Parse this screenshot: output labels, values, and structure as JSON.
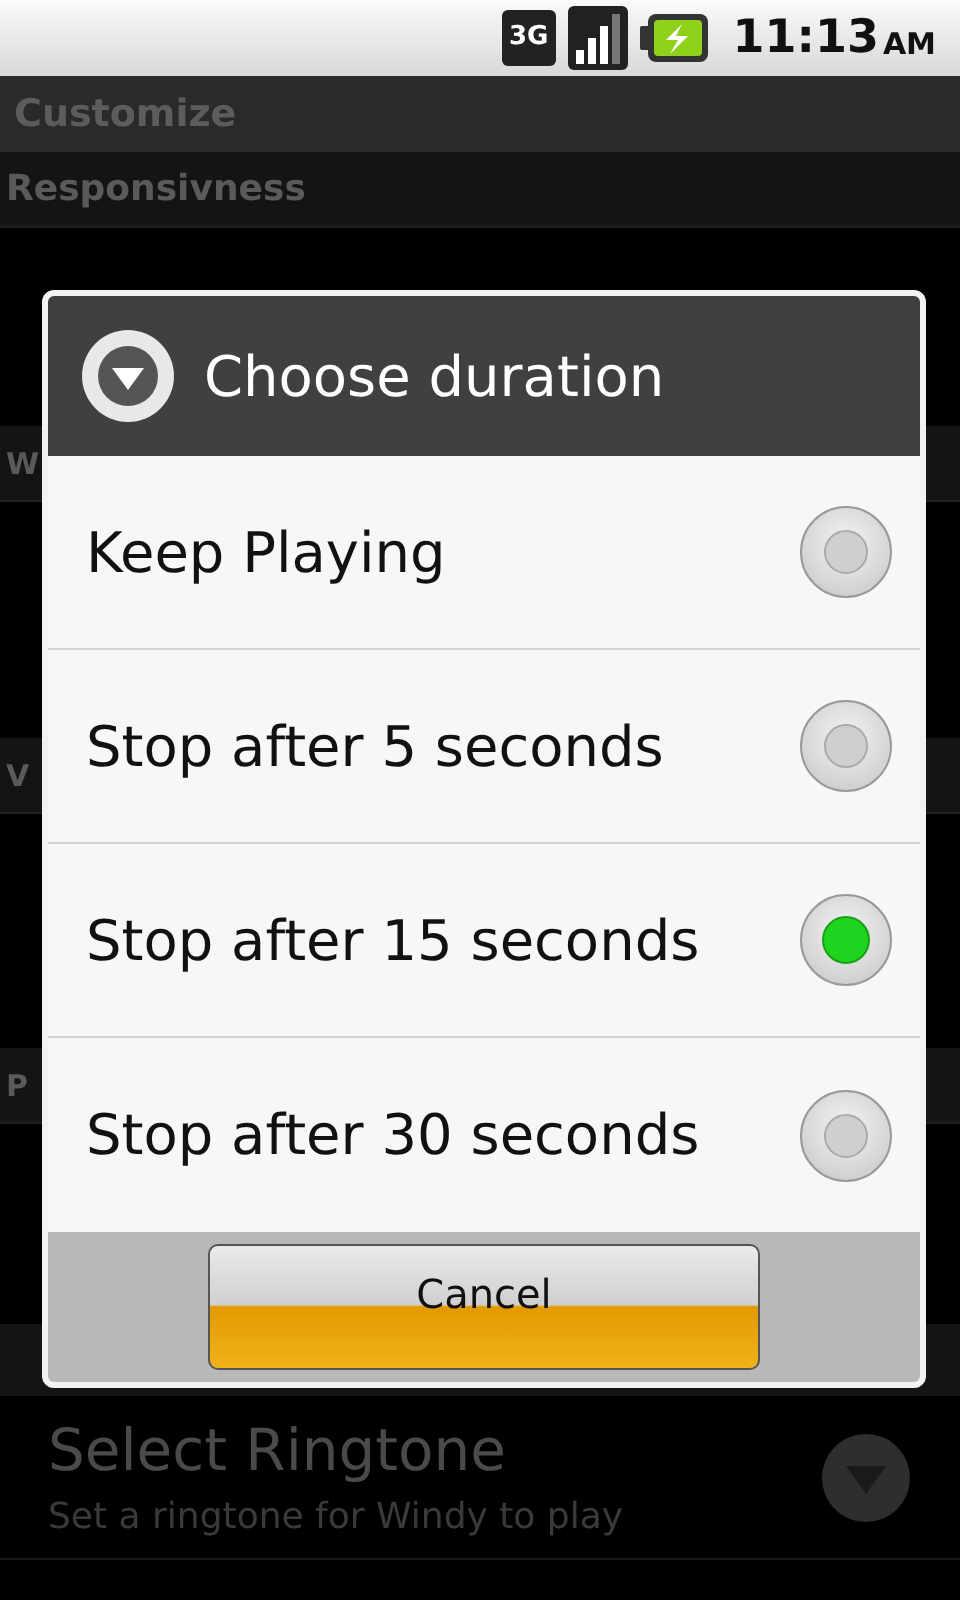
{
  "status_bar": {
    "network": "3G",
    "time": "11:13",
    "meridiem": "AM"
  },
  "background": {
    "title": "Customize",
    "headers": [
      "Responsivness",
      "W",
      "V",
      "P"
    ],
    "item": {
      "title": "Select Ringtone",
      "summary": "Set a ringtone for Windy to play"
    }
  },
  "dialog": {
    "title": "Choose duration",
    "options": [
      {
        "label": "Keep Playing",
        "selected": false
      },
      {
        "label": "Stop after 5 seconds",
        "selected": false
      },
      {
        "label": "Stop after 15 seconds",
        "selected": true
      },
      {
        "label": "Stop after 30 seconds",
        "selected": false
      }
    ],
    "button": "Cancel"
  }
}
